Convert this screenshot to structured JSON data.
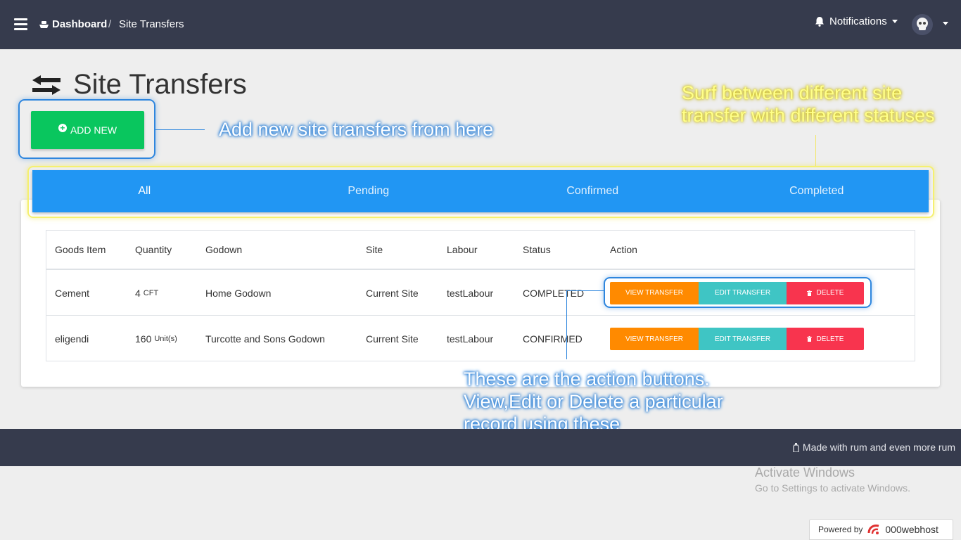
{
  "navbar": {
    "brand": "Dashboard",
    "separator": "/",
    "current": "Site Transfers",
    "notifications": "Notifications"
  },
  "page": {
    "title": "Site Transfers",
    "add_button": "ADD NEW"
  },
  "annotations": {
    "add_note": "Add new site transfers from here",
    "tabs_note_line1": "Surf between different site",
    "tabs_note_line2": "transfer with different statuses",
    "actions_note_line1": "These are the action buttons.",
    "actions_note_line2": "View,Edit or Delete a particular",
    "actions_note_line3": "record using these"
  },
  "tabs": [
    "All",
    "Pending",
    "Confirmed",
    "Completed"
  ],
  "table": {
    "headers": [
      "Goods Item",
      "Quantity",
      "Godown",
      "Site",
      "Labour",
      "Status",
      "Action"
    ],
    "rows": [
      {
        "item": "Cement",
        "qty": "4",
        "unit": "CFT",
        "godown": "Home Godown",
        "site": "Current Site",
        "labour": "testLabour",
        "status": "COMPLETED"
      },
      {
        "item": "eligendi",
        "qty": "160",
        "unit": "Unit(s)",
        "godown": "Turcotte and Sons Godown",
        "site": "Current Site",
        "labour": "testLabour",
        "status": "CONFIRMED"
      }
    ],
    "actions": {
      "view": "VIEW TRANSFER",
      "edit": "EDIT TRANSFER",
      "delete": "DELETE"
    }
  },
  "footer": {
    "text": "Made with rum and even more rum"
  },
  "watermark": {
    "title": "Activate Windows",
    "subtitle": "Go to Settings to activate Windows."
  },
  "powered": {
    "label": "Powered by",
    "brand": "000webhost"
  },
  "colors": {
    "navbar": "#363b4d",
    "tabs": "#2196f3",
    "add_button": "#09c65e",
    "view": "#ff8a00",
    "edit": "#3fc5c4",
    "delete": "#f8344e"
  },
  "icons": [
    "hamburger-icon",
    "ship-icon",
    "bell-icon",
    "skull-avatar",
    "transfer-arrows-icon",
    "plus-circle-icon",
    "trash-icon",
    "bottle-icon",
    "webhost-logo-icon"
  ]
}
